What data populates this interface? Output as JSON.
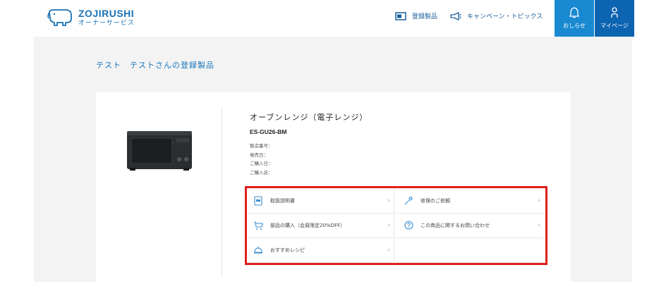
{
  "header": {
    "logo_name": "ZOJIRUSHI",
    "logo_sub": "オーナーサービス",
    "nav": [
      {
        "label": "登録製品",
        "icon": "monitor-icon"
      },
      {
        "label": "キャンペーン・トピックス",
        "icon": "megaphone-icon"
      }
    ],
    "notice_label": "おしらせ",
    "mypage_label": "マイページ"
  },
  "page": {
    "title": "テスト　テストさんの登録製品"
  },
  "product": {
    "name": "オーブンレンジ（電子レンジ）",
    "model": "ES-GU26-BM",
    "meta": [
      "製造番号：",
      "発売日：",
      "ご購入日：",
      "ご購入店："
    ]
  },
  "actions": [
    {
      "label": "取扱説明書",
      "icon": "manual-icon"
    },
    {
      "label": "修理のご依頼",
      "icon": "wrench-icon"
    },
    {
      "label": "部品の購入（会員限定20%OFF）",
      "icon": "cart-icon"
    },
    {
      "label": "この商品に関するお問い合わせ",
      "icon": "question-icon"
    },
    {
      "label": "おすすめレシピ",
      "icon": "cloche-icon"
    }
  ],
  "chevron": "›",
  "colors": {
    "brand_blue": "#1a73b6",
    "notice_bg": "#1989d2",
    "mypage_bg": "#0d64b1",
    "highlight": "#e0201b",
    "main_bg": "#f3f3f3"
  }
}
